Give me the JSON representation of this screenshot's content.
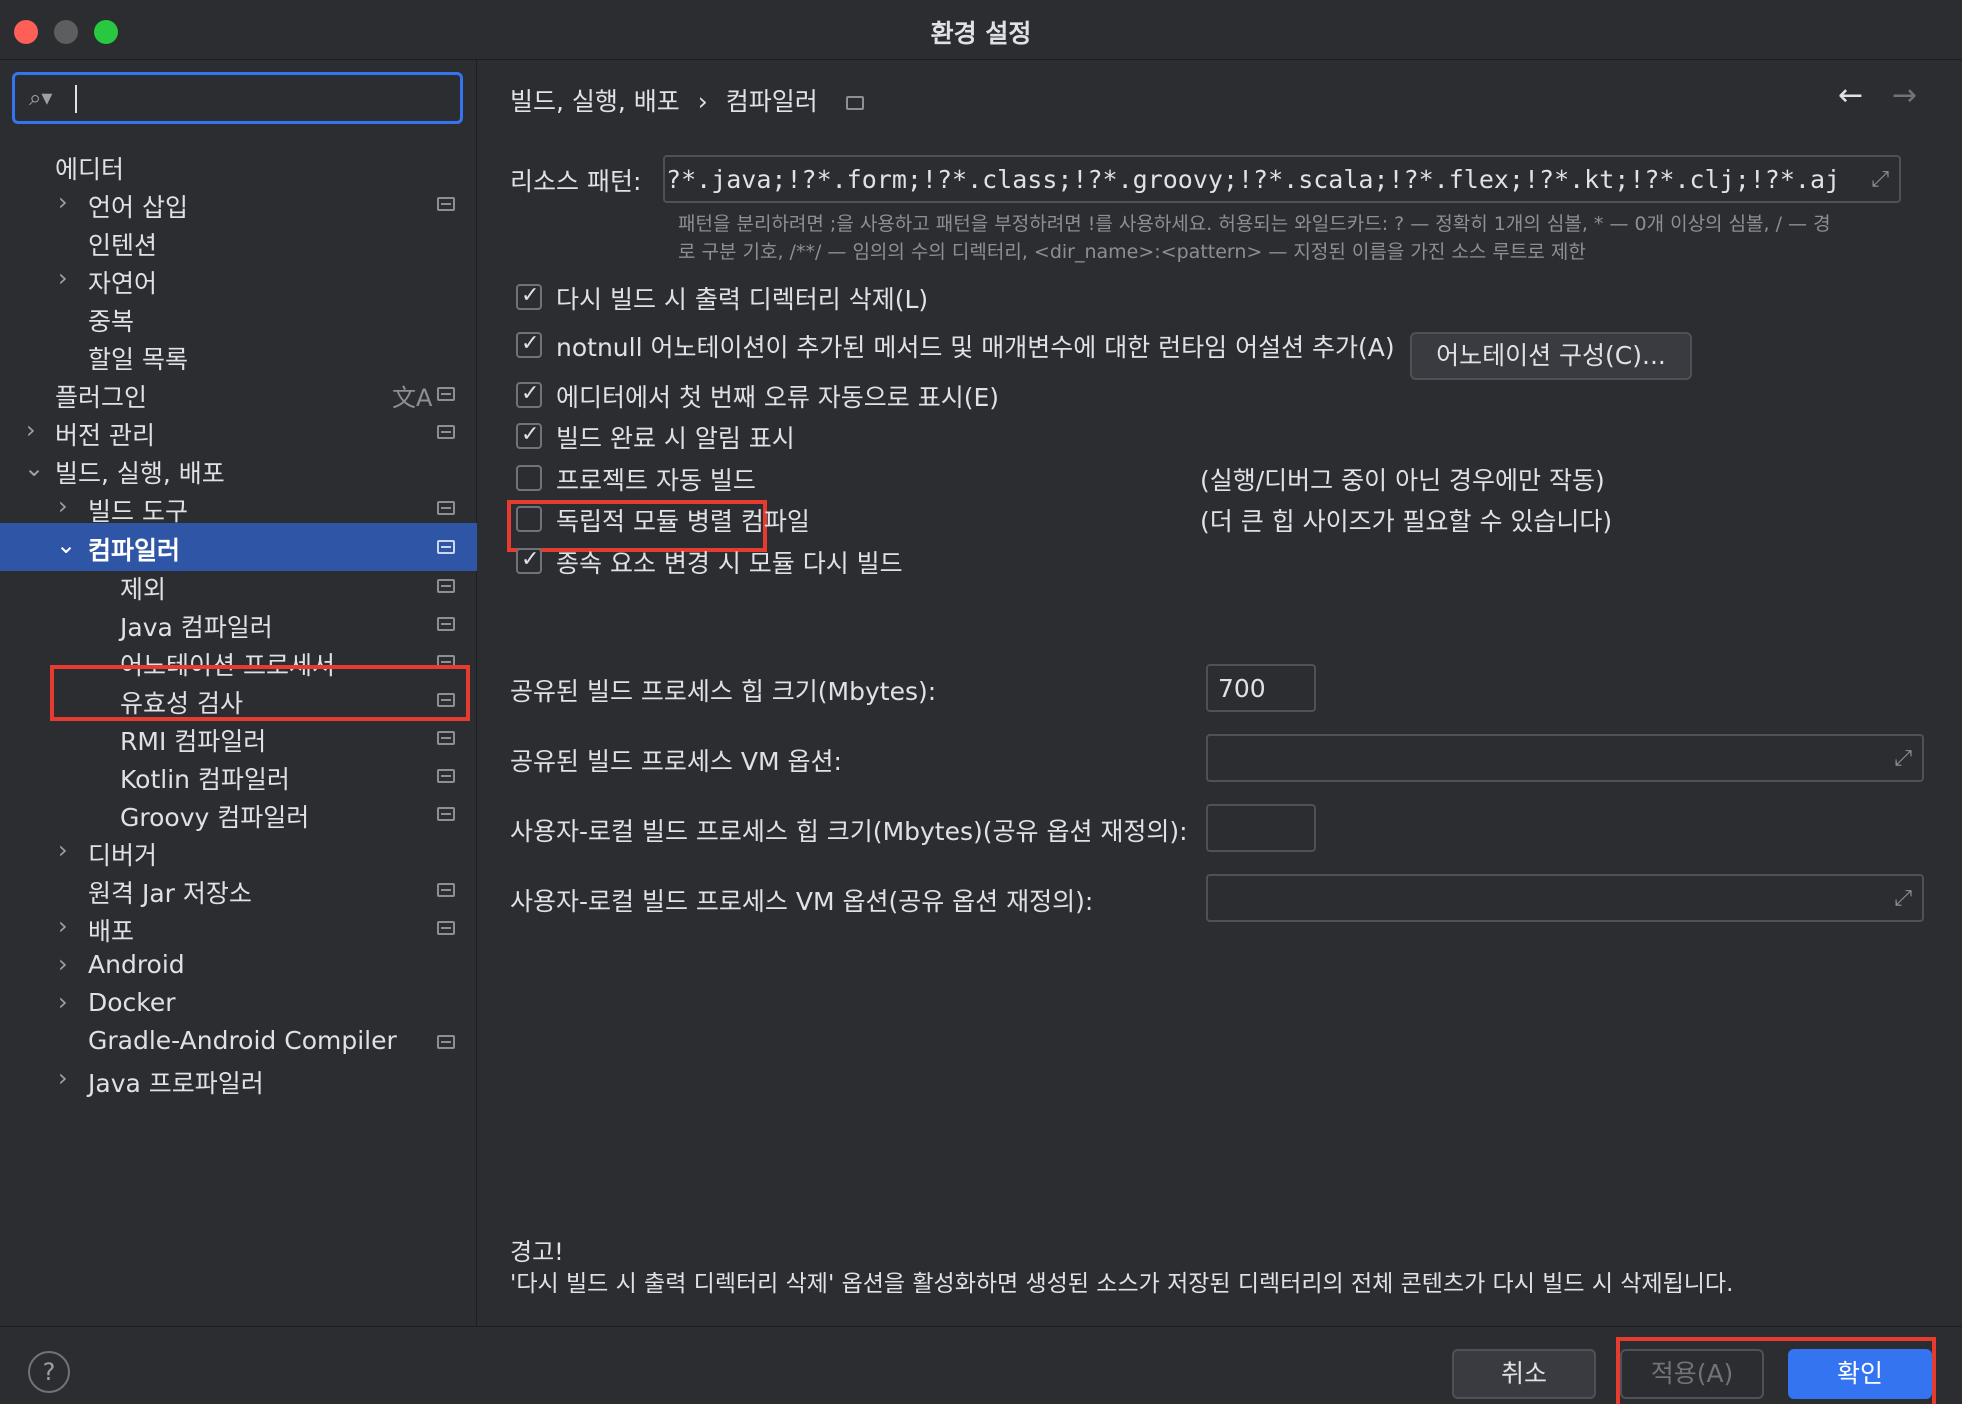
{
  "window": {
    "title": "환경 설정"
  },
  "colors": {
    "accent": "#3574f0",
    "selection": "#2e55a6",
    "highlight_outline": "#e53c2f"
  },
  "search": {
    "placeholder": "",
    "icon": "search-icon"
  },
  "sidebar": {
    "items": [
      {
        "label": "에디터"
      },
      {
        "label": "언어 삽입"
      },
      {
        "label": "인텐션"
      },
      {
        "label": "자연어"
      },
      {
        "label": "중복"
      },
      {
        "label": "할일 목록"
      },
      {
        "label": "플러그인"
      },
      {
        "label": "버전 관리"
      },
      {
        "label": "빌드, 실행, 배포"
      },
      {
        "label": "빌드 도구"
      },
      {
        "label": "컴파일러"
      },
      {
        "label": "제외"
      },
      {
        "label": "Java 컴파일러"
      },
      {
        "label": "어노테이션 프로세서"
      },
      {
        "label": "유효성 검사"
      },
      {
        "label": "RMI 컴파일러"
      },
      {
        "label": "Kotlin 컴파일러"
      },
      {
        "label": "Groovy 컴파일러"
      },
      {
        "label": "디버거"
      },
      {
        "label": "원격 Jar 저장소"
      },
      {
        "label": "배포"
      },
      {
        "label": "Android"
      },
      {
        "label": "Docker"
      },
      {
        "label": "Gradle-Android Compiler"
      },
      {
        "label": "Java 프로파일러"
      }
    ]
  },
  "main": {
    "breadcrumb": [
      "빌드, 실행, 배포",
      "›",
      "컴파일러"
    ],
    "resource_patterns": {
      "label": "리소스 패턴:",
      "value": "!?*.java;!?*.form;!?*.class;!?*.groovy;!?*.scala;!?*.flex;!?*.kt;!?*.clj;!?*.aj",
      "hint_line1": "패턴을 분리하려면 ;을 사용하고 패턴을 부정하려면 !를 사용하세요. 허용되는 와일드카드: ? — 정확히 1개의 심볼, * — 0개 이상의 심볼, / — 경",
      "hint_line2": "로 구분 기호, /**/ — 임의의 수의 디렉터리, <dir_name>:<pattern> — 지정된 이름을 가진 소스 루트로 제한"
    },
    "checkboxes": [
      {
        "label": "다시 빌드 시 출력 디렉터리 삭제(L)",
        "checked": true
      },
      {
        "label": "notnull 어노테이션이 추가된 메서드 및 매개변수에 대한 런타임 어설션 추가(A)",
        "checked": true
      },
      {
        "label": "에디터에서 첫 번째 오류 자동으로 표시(E)",
        "checked": true
      },
      {
        "label": "빌드 완료 시 알림 표시",
        "checked": true
      },
      {
        "label": "프로젝트 자동 빌드",
        "checked": false,
        "note": "(실행/디버그 중이 아닌 경우에만 작동)"
      },
      {
        "label": "독립적 모듈 병렬 컴파일",
        "checked": false,
        "note": "(더 큰 힙 사이즈가 필요할 수 있습니다)"
      },
      {
        "label": "종속 요소 변경 시 모듈 다시 빌드",
        "checked": true
      }
    ],
    "annotation_button": "어노테이션 구성(C)...",
    "fields": [
      {
        "label": "공유된 빌드 프로세스 힙 크기(Mbytes):",
        "value": "700"
      },
      {
        "label": "공유된 빌드 프로세스 VM 옵션:",
        "value": ""
      },
      {
        "label": "사용자-로컬 빌드 프로세스 힙 크기(Mbytes)(공유 옵션 재정의):",
        "value": ""
      },
      {
        "label": "사용자-로컬 빌드 프로세스 VM 옵션(공유 옵션 재정의):",
        "value": ""
      }
    ],
    "warning": {
      "title": "경고!",
      "body": "'다시 빌드 시 출력 디렉터리 삭제' 옵션을 활성화하면 생성된 소스가 저장된 디렉터리의 전체 콘텐츠가 다시 빌드 시 삭제됩니다."
    }
  },
  "footer": {
    "help": "?",
    "cancel": "취소",
    "apply": "적용(A)",
    "ok": "확인"
  }
}
